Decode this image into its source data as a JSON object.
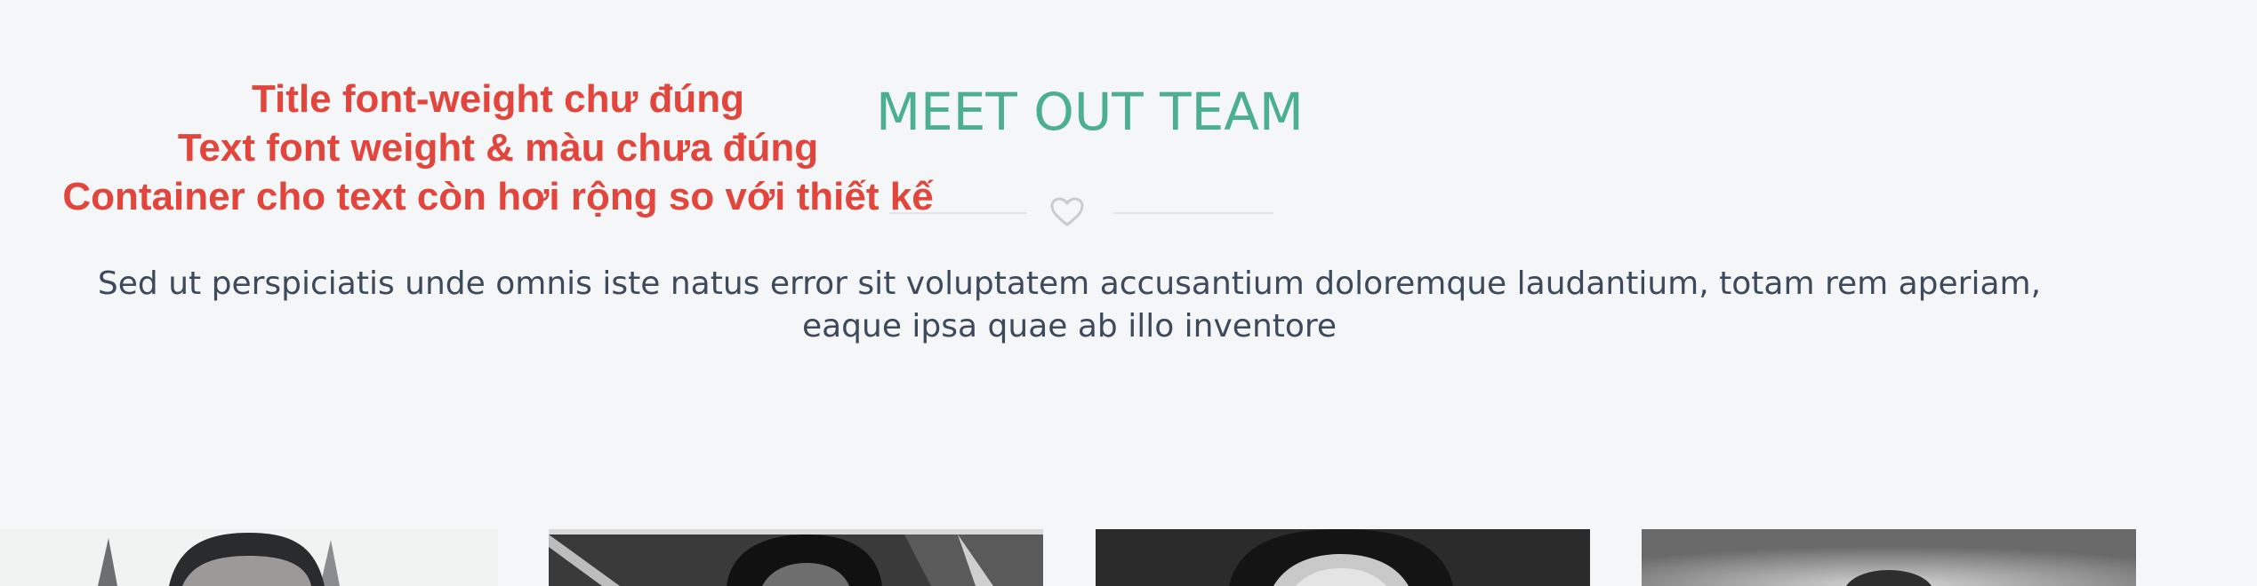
{
  "annotations": [
    "Title font-weight chư đúng",
    "Text font weight & màu chưa đúng",
    "Container cho text còn hơi rộng so với thiết kế"
  ],
  "section": {
    "title": "MEET OUT TEAM",
    "divider_icon": "heart-icon",
    "intro": "Sed ut perspiciatis unde omnis iste natus error sit voluptatem accusantium doloremque laudantium, totam rem aperiam, eaque ipsa quae ab illo inventore"
  },
  "colors": {
    "background": "#f4f6f8",
    "title": "#4caf8e",
    "annotation": "#e2453c",
    "text": "#3d4a5c",
    "divider": "#e2e4e7"
  },
  "team": [
    {
      "photo": "member-photo-1"
    },
    {
      "photo": "member-photo-2"
    },
    {
      "photo": "member-photo-3"
    },
    {
      "photo": "member-photo-4"
    }
  ]
}
